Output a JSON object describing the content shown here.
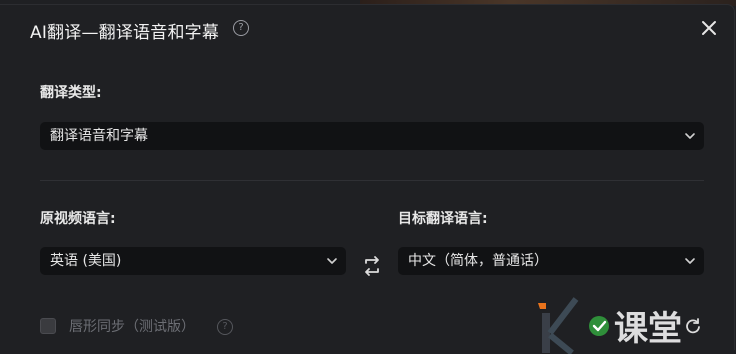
{
  "dialog": {
    "title": "AI翻译—翻译语音和字幕",
    "help_icon": "?",
    "close_icon": "close-icon"
  },
  "translation_type": {
    "label": "翻译类型:",
    "selected": "翻译语音和字幕"
  },
  "source_language": {
    "label": "原视频语言:",
    "selected": "英语 (美国)"
  },
  "target_language": {
    "label": "目标翻译语言:",
    "selected": "中文（简体，普通话）"
  },
  "lip_sync": {
    "label": "唇形同步（测试版）",
    "checked": false,
    "enabled": false
  },
  "watermark": {
    "text": "课堂",
    "brand_color": "#e8731c"
  }
}
